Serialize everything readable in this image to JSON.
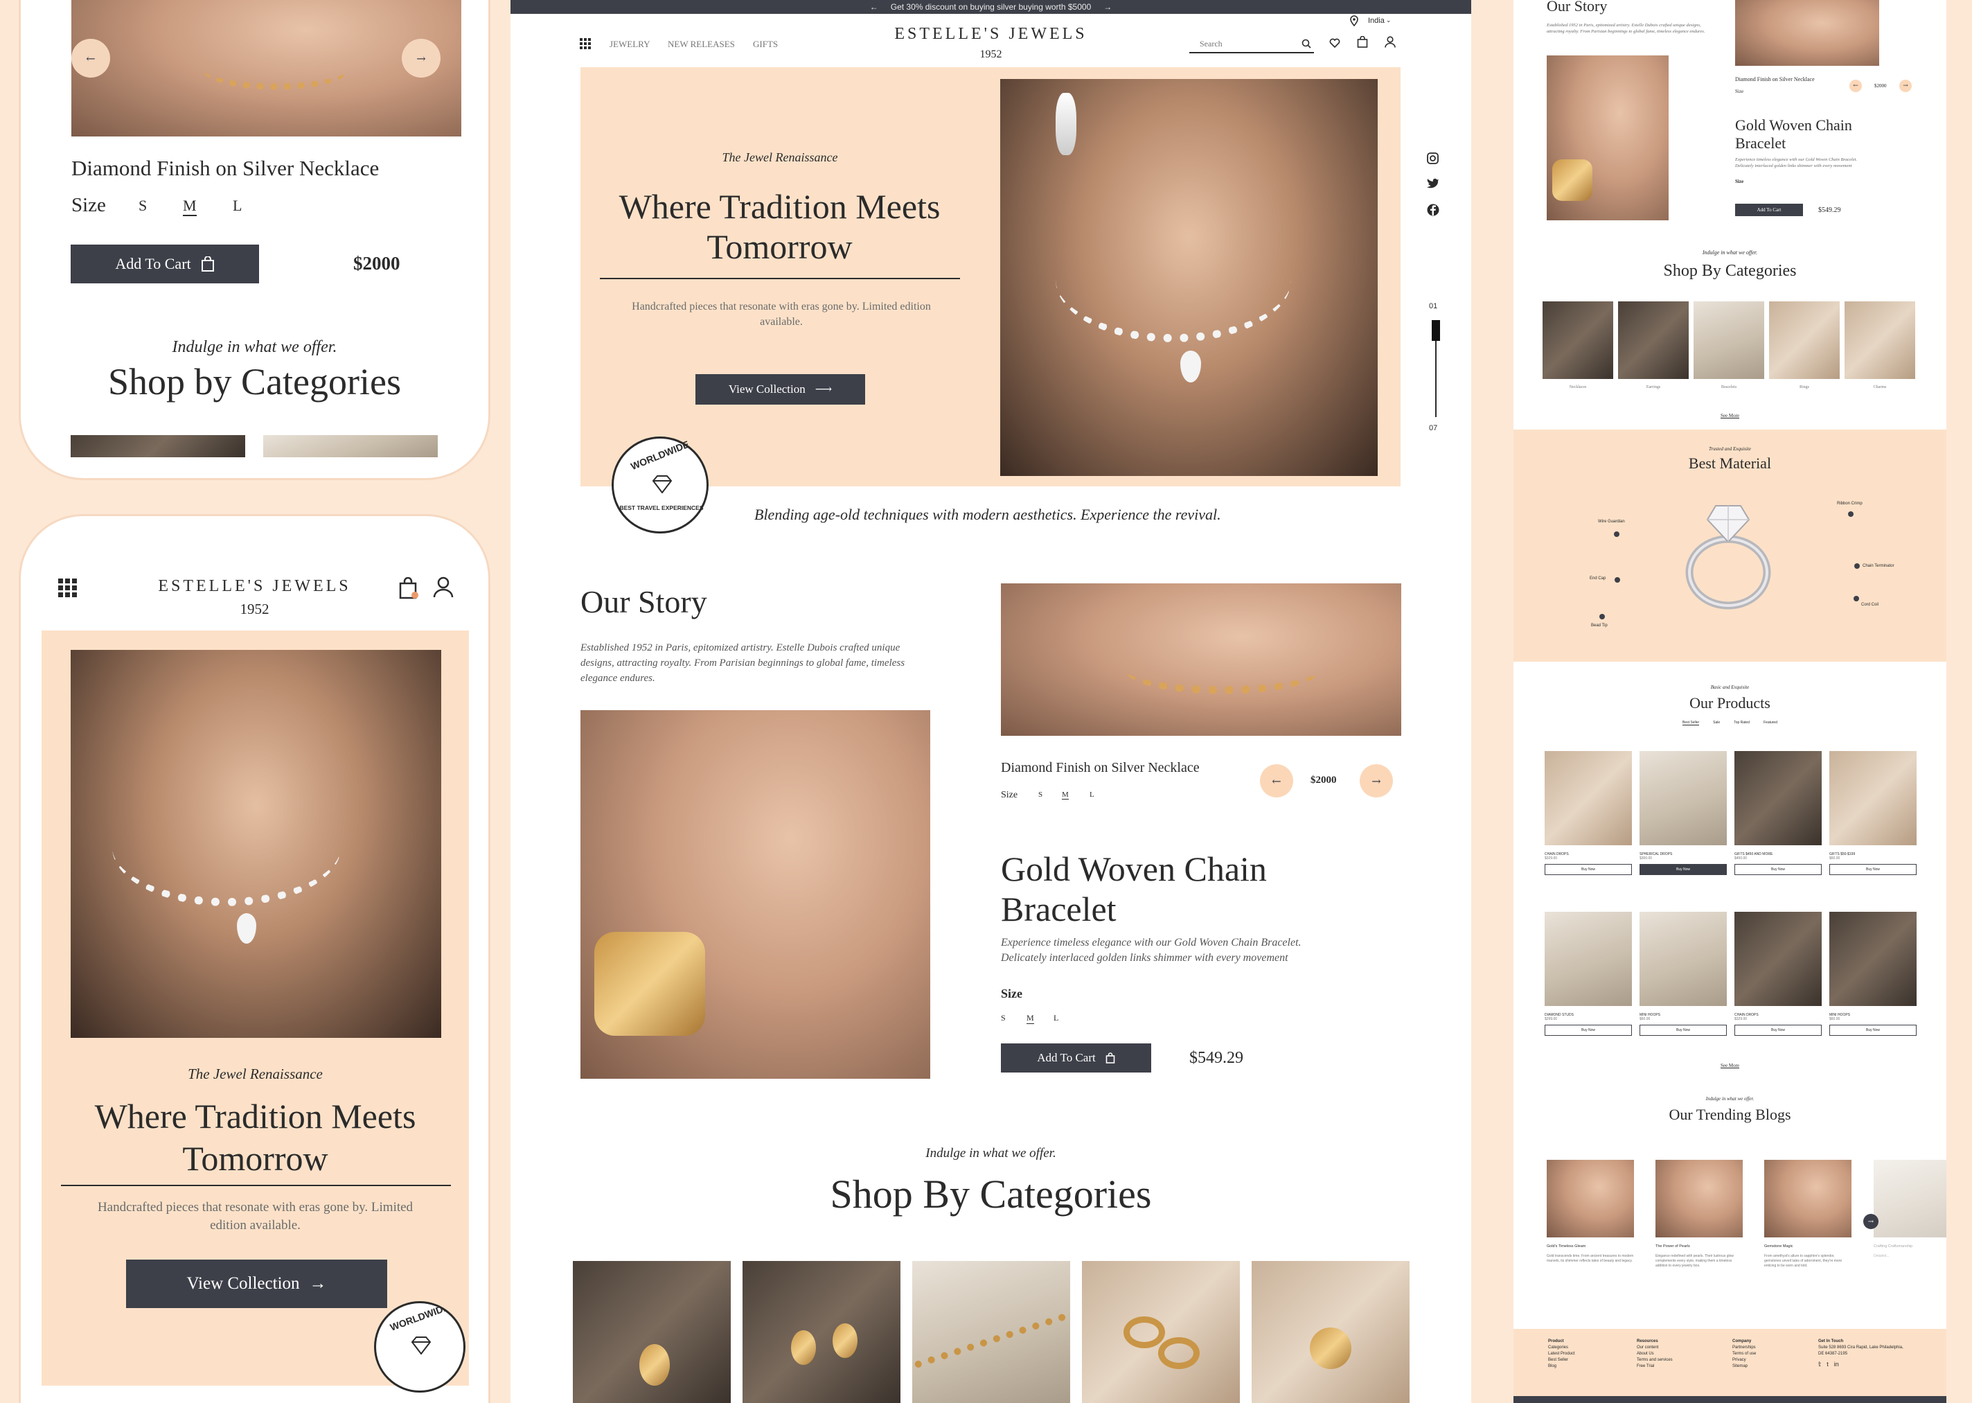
{
  "topbar": {
    "announcement": "Get 30% discount on buying silver buying worth $5000",
    "prev": "←",
    "next": "→"
  },
  "brand": {
    "name": "ESTELLE'S JEWELS",
    "year": "1952"
  },
  "nav": {
    "items": [
      "JEWELRY",
      "NEW RELEASES",
      "GIFTS"
    ],
    "search_placeholder": "Search",
    "region": "India"
  },
  "hero": {
    "eyebrow": "The Jewel Renaissance",
    "title_line1": "Where Tradition Meets",
    "title_line2": "Tomorrow",
    "subtitle": "Handcrafted pieces that resonate with eras gone by. Limited edition available.",
    "cta": "View Collection",
    "badge_top": "WORLDWIDE",
    "badge_bottom": "BEST TRAVEL EXPERIENCES",
    "tagline": "Blending age-old techniques with modern aesthetics. Experience the revival.",
    "slide_start": "01",
    "slide_end": "07"
  },
  "story": {
    "title": "Our Story",
    "text": "Established 1952 in Paris, epitomized artistry. Estelle Dubois crafted unique designs, attracting royalty. From Parisian beginnings to global fame, timeless elegance endures.",
    "featured": {
      "name": "Diamond Finish on Silver Necklace",
      "size_label": "Size",
      "sizes": [
        "S",
        "M",
        "L"
      ],
      "price": "$2000"
    },
    "product": {
      "title_line1": "Gold Woven Chain",
      "title_line2": "Bracelet",
      "description": "Experience timeless elegance with our Gold Woven Chain Bracelet. Delicately interlaced golden links shimmer with every movement",
      "size_label": "Size",
      "sizes": [
        "S",
        "M",
        "L"
      ],
      "cta": "Add To Cart",
      "price": "$549.29"
    }
  },
  "categories": {
    "eyebrow": "Indulge in what we offer.",
    "title": "Shop By Categories",
    "mobile_title": "Shop by Categories",
    "items": [
      "Necklaces",
      "Earrings",
      "Bracelets",
      "Rings",
      "Charms"
    ],
    "see_more": "See More"
  },
  "mobile_top": {
    "product": "Diamond Finish on Silver Necklace",
    "size_label": "Size",
    "sizes": [
      "S",
      "M",
      "L"
    ],
    "cta": "Add To Cart",
    "price": "$2000"
  },
  "material": {
    "eyebrow": "Trusted and Exquisite",
    "title": "Best Material",
    "labels": [
      "Wire Guardian",
      "Ribbon Crimp",
      "End Cap",
      "Chain Terminator",
      "Bead Tip",
      "Cord Coil"
    ]
  },
  "products": {
    "eyebrow": "Basic and Exquisite",
    "title": "Our Products",
    "tabs": [
      "Best Seller",
      "Sale",
      "Top Rated",
      "Featured"
    ],
    "items": [
      {
        "name": "CHAIN DROPS",
        "price": "$329.00",
        "cta": "Buy Now"
      },
      {
        "name": "SPHERICAL DROPS",
        "price": "$300.00",
        "cta": "Buy Now"
      },
      {
        "name": "GIFTS $450 AND MORE",
        "price": "$450.00",
        "cta": "Buy Now"
      },
      {
        "name": "GIFTS $50-$199",
        "price": "$60.00",
        "cta": "Buy Now"
      },
      {
        "name": "DIAMOND STUDS",
        "price": "$299.00",
        "cta": "Buy Now"
      },
      {
        "name": "MINI HOOPS",
        "price": "$60.00",
        "cta": "Buy Now"
      },
      {
        "name": "CHAIN DROPS",
        "price": "$329.00",
        "cta": "Buy Now"
      },
      {
        "name": "MINI HOOPS",
        "price": "$60.00",
        "cta": "Buy Now"
      }
    ],
    "see_more": "See More"
  },
  "blogs": {
    "eyebrow": "Indulge in what we offer.",
    "title": "Our Trending Blogs",
    "items": [
      {
        "title": "Gold's Timeless Gleam",
        "text": "Gold transcends time. From ancient treasures to modern marvels, its shimmer reflects tales of beauty and legacy."
      },
      {
        "title": "The Power of Pearls",
        "text": "Elegance redefined with pearls. Their lustrous glow complements every style, making them a timeless addition to every jewelry box."
      },
      {
        "title": "Gemstone Magic",
        "text": "From amethyst's allure to sapphire's splendor, gemstones unveil tales of adornment, they're more enticing to be worn and told."
      },
      {
        "title": "Crafting Craftsmanship",
        "text": "Detailed..."
      }
    ]
  },
  "footer": {
    "columns": [
      {
        "title": "Product",
        "items": [
          "Categories",
          "Latest Product",
          "Best Seller",
          "Blog"
        ]
      },
      {
        "title": "Resources",
        "items": [
          "Our content",
          "About Us",
          "Terms and services",
          "Free Trial"
        ]
      },
      {
        "title": "Company",
        "items": [
          "Partnerships",
          "Terms of use",
          "Privacy",
          "Sitemap"
        ]
      },
      {
        "title": "Get In Touch",
        "items": [
          "Suite 528 8693 Cira Rapid, Lake Philadelphia, DE 64387-2195"
        ]
      }
    ]
  },
  "colors": {
    "peach": "#fce1c8",
    "dark": "#3d4049",
    "background": "#fde8d6"
  }
}
